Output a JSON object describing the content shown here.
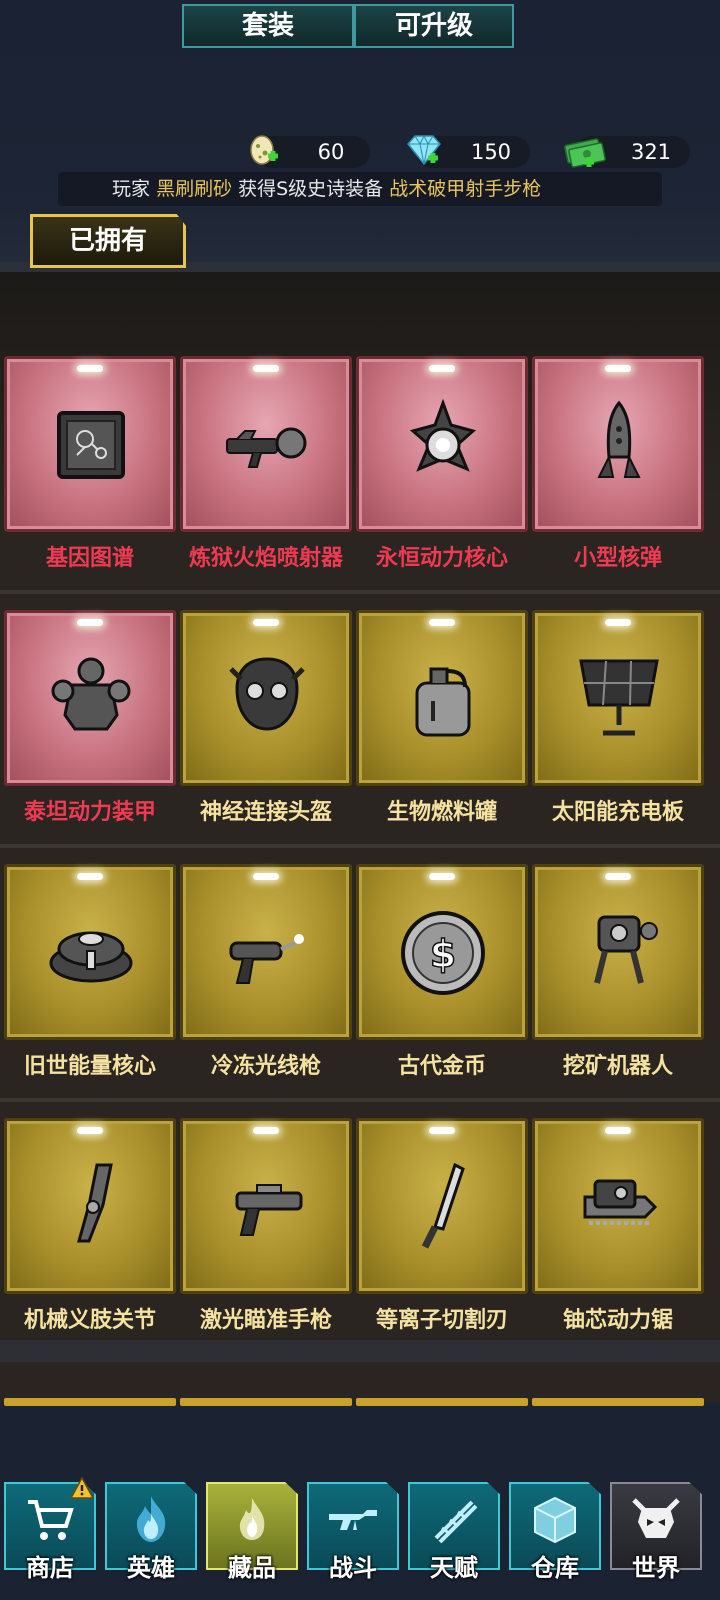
{
  "resources": [
    {
      "icon": "egg-icon",
      "value": "60"
    },
    {
      "icon": "diamond-icon",
      "value": "150"
    },
    {
      "icon": "cash-icon",
      "value": "321"
    }
  ],
  "news": {
    "prefix": "玩家",
    "player": "黑刷刷砂",
    "middle": "获得S级史诗装备",
    "item": "战术破甲射手步枪"
  },
  "tabs": [
    "已拥有",
    "套装",
    "可升级"
  ],
  "items": [
    {
      "name": "基因图谱",
      "rarity": "red",
      "icon": "gene-map-icon"
    },
    {
      "name": "炼狱火焰喷射器",
      "rarity": "red",
      "icon": "flamethrower-icon"
    },
    {
      "name": "永恒动力核心",
      "rarity": "red",
      "icon": "power-core-icon"
    },
    {
      "name": "小型核弹",
      "rarity": "red",
      "icon": "nuke-icon"
    },
    {
      "name": "泰坦动力装甲",
      "rarity": "red",
      "icon": "power-armor-icon"
    },
    {
      "name": "神经连接头盔",
      "rarity": "gold",
      "icon": "neural-helmet-icon"
    },
    {
      "name": "生物燃料罐",
      "rarity": "gold",
      "icon": "fuel-tank-icon"
    },
    {
      "name": "太阳能充电板",
      "rarity": "gold",
      "icon": "solar-panel-icon"
    },
    {
      "name": "旧世能量核心",
      "rarity": "gold",
      "icon": "energy-core-icon"
    },
    {
      "name": "冷冻光线枪",
      "rarity": "gold",
      "icon": "freeze-ray-icon"
    },
    {
      "name": "古代金币",
      "rarity": "gold",
      "icon": "coin-icon"
    },
    {
      "name": "挖矿机器人",
      "rarity": "gold",
      "icon": "mining-robot-icon"
    },
    {
      "name": "机械义肢关节",
      "rarity": "gold",
      "icon": "prosthetic-icon"
    },
    {
      "name": "激光瞄准手枪",
      "rarity": "gold",
      "icon": "laser-pistol-icon"
    },
    {
      "name": "等离子切割刃",
      "rarity": "gold",
      "icon": "plasma-blade-icon"
    },
    {
      "name": "铀芯动力锯",
      "rarity": "gold",
      "icon": "chainsaw-icon"
    }
  ],
  "nav": [
    {
      "label": "商店",
      "icon": "cart-icon",
      "state": "normal"
    },
    {
      "label": "英雄",
      "icon": "flame-hero-icon",
      "state": "normal"
    },
    {
      "label": "藏品",
      "icon": "flame-collection-icon",
      "state": "active"
    },
    {
      "label": "战斗",
      "icon": "rifle-icon",
      "state": "normal"
    },
    {
      "label": "天赋",
      "icon": "dna-icon",
      "state": "normal"
    },
    {
      "label": "仓库",
      "icon": "crate-icon",
      "state": "normal"
    },
    {
      "label": "世界",
      "icon": "skull-icon",
      "state": "dark"
    }
  ],
  "colors": {
    "red_card": "#c8727f",
    "gold_card": "#a88f2a",
    "red_label": "#ee3a52",
    "gold_label": "#f5e2a0",
    "accent": "#e8c64a"
  }
}
